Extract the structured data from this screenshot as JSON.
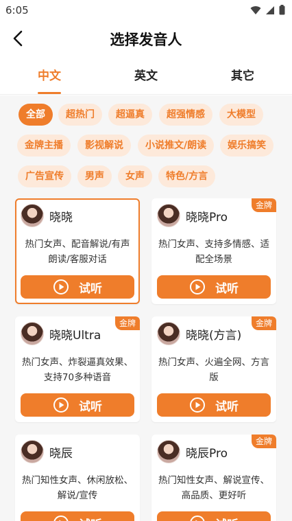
{
  "status_bar": {
    "time": "6:05"
  },
  "header": {
    "title": "选择发音人"
  },
  "tabs": [
    {
      "label": "中文",
      "active": true
    },
    {
      "label": "英文",
      "active": false
    },
    {
      "label": "其它",
      "active": false
    }
  ],
  "filters": [
    {
      "label": "全部",
      "active": true
    },
    {
      "label": "超热门"
    },
    {
      "label": "超逼真"
    },
    {
      "label": "超强情感"
    },
    {
      "label": "大模型"
    },
    {
      "label": "金牌主播"
    },
    {
      "label": "影视解说"
    },
    {
      "label": "小说推文/朗读"
    },
    {
      "label": "娱乐搞笑"
    },
    {
      "label": "广告宣传"
    },
    {
      "label": "男声"
    },
    {
      "label": "女声"
    },
    {
      "label": "特色/方言"
    }
  ],
  "voices": [
    {
      "name": "晓晓",
      "desc": "热门女声、配音解说/有声朗读/客服对话",
      "badge": "",
      "selected": true,
      "listen": "试听"
    },
    {
      "name": "晓晓Pro",
      "desc": "热门女声、支持多情感、适配全场景",
      "badge": "金牌",
      "selected": false,
      "listen": "试听"
    },
    {
      "name": "晓晓Ultra",
      "desc": "热门女声、炸裂逼真效果、支持70多种语音",
      "badge": "金牌",
      "selected": false,
      "listen": "试听"
    },
    {
      "name": "晓晓(方言)",
      "desc": "热门女声、火遍全网、方言版",
      "badge": "金牌",
      "selected": false,
      "listen": "试听"
    },
    {
      "name": "晓辰",
      "desc": "热门知性女声、休闲放松、解说/宣传",
      "badge": "",
      "selected": false,
      "listen": "试听"
    },
    {
      "name": "晓辰Pro",
      "desc": "热门知性女声、解说宣传、高品质、更好听",
      "badge": "金牌",
      "selected": false,
      "listen": "试听"
    }
  ],
  "colors": {
    "accent": "#ef7d2b",
    "chip_bg": "#fde9da",
    "page_bg": "#f6f6f6"
  }
}
